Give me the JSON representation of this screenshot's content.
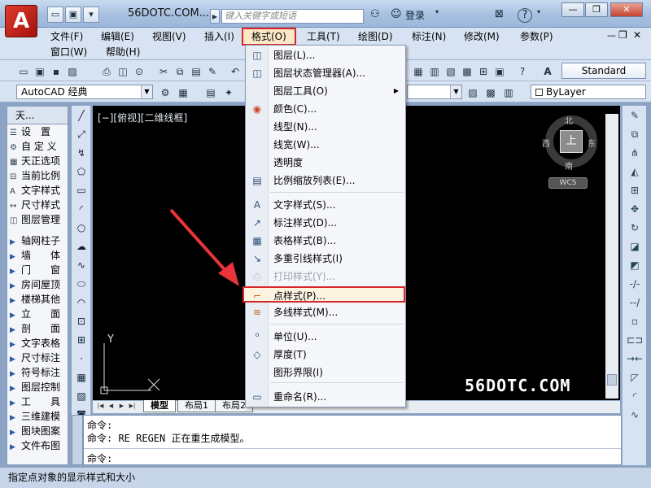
{
  "window": {
    "title": "56DOTC.COM...",
    "search_placeholder": "键入关键字或短语",
    "login_label": "登录",
    "help_label": "?",
    "minimize": "—",
    "restore": "❐",
    "close": "✕"
  },
  "menubar": {
    "row1": [
      "文件(F)",
      "编辑(E)",
      "视图(V)",
      "插入(I)",
      "格式(O)",
      "工具(T)",
      "绘图(D)",
      "标注(N)",
      "修改(M)",
      "参数(P)"
    ],
    "row2": [
      "窗口(W)",
      "帮助(H)"
    ]
  },
  "toolbar": {
    "text_style_combo": "Standard",
    "workspace_combo": "AutoCAD 经典",
    "layer_color": "ByLayer"
  },
  "left_panel": {
    "title": "天...",
    "items": [
      {
        "label": "设　置",
        "icon": "settings-icon"
      },
      {
        "label": "自 定 义",
        "icon": "customize-icon"
      },
      {
        "label": "天正选项",
        "icon": "options-icon"
      },
      {
        "label": "当前比例",
        "icon": "scale-icon"
      },
      {
        "label": "文字样式",
        "icon": "text-style-icon"
      },
      {
        "label": "尺寸样式",
        "icon": "dim-style-icon"
      },
      {
        "label": "图层管理",
        "icon": "layer-icon"
      },
      {
        "label": "轴网柱子",
        "icon": "arrow-icon"
      },
      {
        "label": "墙　　体",
        "icon": "arrow-icon"
      },
      {
        "label": "门　　窗",
        "icon": "arrow-icon"
      },
      {
        "label": "房间屋顶",
        "icon": "arrow-icon"
      },
      {
        "label": "楼梯其他",
        "icon": "arrow-icon"
      },
      {
        "label": "立　　面",
        "icon": "arrow-icon"
      },
      {
        "label": "剖　　面",
        "icon": "arrow-icon"
      },
      {
        "label": "文字表格",
        "icon": "arrow-icon"
      },
      {
        "label": "尺寸标注",
        "icon": "arrow-icon"
      },
      {
        "label": "符号标注",
        "icon": "arrow-icon"
      },
      {
        "label": "图层控制",
        "icon": "arrow-icon"
      },
      {
        "label": "工　　具",
        "icon": "arrow-icon"
      },
      {
        "label": "三维建模",
        "icon": "arrow-icon"
      },
      {
        "label": "图块图案",
        "icon": "arrow-icon"
      },
      {
        "label": "文件布图",
        "icon": "arrow-icon"
      }
    ]
  },
  "viewport": {
    "label": "[−][俯视][二维线框]",
    "compass": {
      "north": "北",
      "south": "南",
      "east": "东",
      "west": "西",
      "center": "上"
    },
    "wcs": "WCS",
    "watermark": "56DOTC.COM",
    "ucs_y": "Y",
    "ucs_x": "X"
  },
  "layout_tabs": [
    "模型",
    "布局1",
    "布局2"
  ],
  "format_menu": {
    "items": [
      {
        "label": "图层(L)...",
        "icon": "layer-icon"
      },
      {
        "label": "图层状态管理器(A)...",
        "icon": "layer-state-icon"
      },
      {
        "label": "图层工具(O)",
        "icon": "",
        "submenu": "▶"
      },
      {
        "label": "颜色(C)...",
        "icon": "color-wheel-icon"
      },
      {
        "label": "线型(N)...",
        "icon": ""
      },
      {
        "label": "线宽(W)...",
        "icon": ""
      },
      {
        "label": "透明度",
        "icon": ""
      },
      {
        "label": "比例缩放列表(E)...",
        "icon": "scale-list-icon"
      },
      {
        "label": "文字样式(S)...",
        "icon": "text-style-icon"
      },
      {
        "label": "标注样式(D)...",
        "icon": "dim-style-icon"
      },
      {
        "label": "表格样式(B)...",
        "icon": "table-style-icon"
      },
      {
        "label": "多重引线样式(I)",
        "icon": "mleader-style-icon"
      },
      {
        "label": "打印样式(Y)...",
        "icon": "plot-style-icon",
        "disabled": true
      },
      {
        "label": "点样式(P)...",
        "icon": "point-style-icon",
        "highlight": true
      },
      {
        "label": "多线样式(M)...",
        "icon": "mline-style-icon"
      },
      {
        "label": "单位(U)...",
        "icon": "units-icon"
      },
      {
        "label": "厚度(T)",
        "icon": "thickness-icon"
      },
      {
        "label": "图形界限(I)",
        "icon": ""
      },
      {
        "label": "重命名(R)...",
        "icon": "rename-icon"
      }
    ]
  },
  "command": {
    "line1": "命令:",
    "line2": "命令: RE REGEN 正在重生成模型。",
    "prompt": "命令:"
  },
  "status_text": "指定点对象的显示样式和大小",
  "colors": {
    "highlight_border": "#d9262b",
    "arrow": "#e8343a"
  }
}
